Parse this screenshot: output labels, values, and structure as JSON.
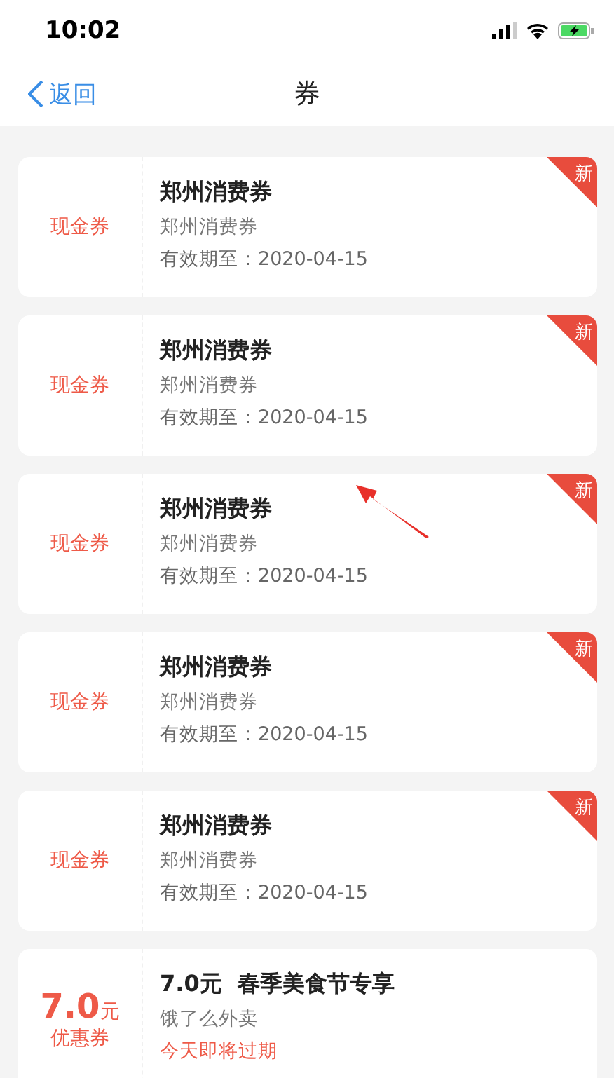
{
  "status_bar": {
    "time": "10:02"
  },
  "nav": {
    "back": "返回",
    "title": "券"
  },
  "coupons": [
    {
      "kind": "cash",
      "type_label": "现金券",
      "title": "郑州消费券",
      "subtitle": "郑州消费券",
      "validity": "有效期至：2020-04-15",
      "badge": "新"
    },
    {
      "kind": "cash",
      "type_label": "现金券",
      "title": "郑州消费券",
      "subtitle": "郑州消费券",
      "validity": "有效期至：2020-04-15",
      "badge": "新"
    },
    {
      "kind": "cash",
      "type_label": "现金券",
      "title": "郑州消费券",
      "subtitle": "郑州消费券",
      "validity": "有效期至：2020-04-15",
      "badge": "新"
    },
    {
      "kind": "cash",
      "type_label": "现金券",
      "title": "郑州消费券",
      "subtitle": "郑州消费券",
      "validity": "有效期至：2020-04-15",
      "badge": "新"
    },
    {
      "kind": "cash",
      "type_label": "现金券",
      "title": "郑州消费券",
      "subtitle": "郑州消费券",
      "validity": "有效期至：2020-04-15",
      "badge": "新"
    },
    {
      "kind": "discount",
      "amount": "7.0",
      "unit": "元",
      "type_label": "优惠券",
      "title": "7.0元  春季美食节专享",
      "subtitle": "饿了么外卖",
      "validity": "今天即将过期"
    }
  ]
}
